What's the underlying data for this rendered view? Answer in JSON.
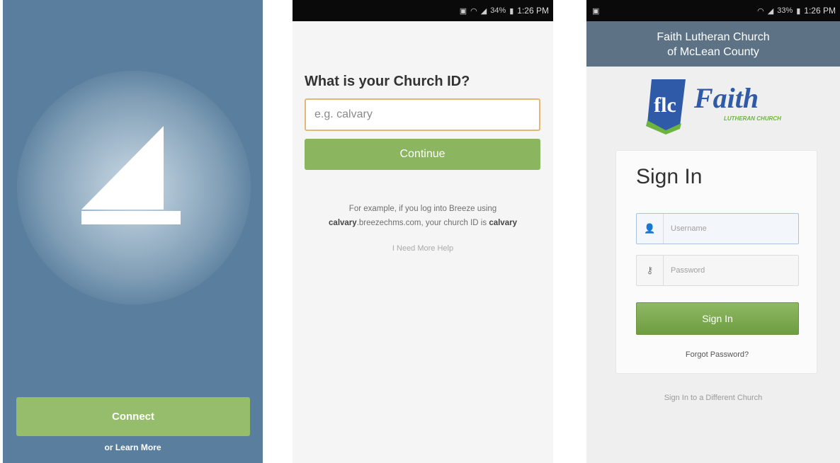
{
  "screen_splash": {
    "connect_label": "Connect",
    "learn_more_label": "or Learn More",
    "background_color": "#5a7f9e",
    "button_color": "#96bd6b"
  },
  "screen_church_id": {
    "status_time": "1:26 PM",
    "status_battery": "34%",
    "question": "What is your Church ID?",
    "input_placeholder": "e.g. calvary",
    "continue_label": "Continue",
    "help_line1": "For example, if you log into Breeze using",
    "help_domain_bold": "calvary",
    "help_domain_rest": ".breezechms.com, your church ID is",
    "help_id_bold": "calvary",
    "more_help_label": "I Need More Help",
    "accent_color": "#8bb55e"
  },
  "screen_signin": {
    "status_time": "1:26 PM",
    "status_battery": "33%",
    "header_line1": "Faith Lutheran Church",
    "header_line2": "of McLean County",
    "logo_mark": "flc",
    "logo_word": "Faith",
    "logo_sub": "LUTHERAN CHURCH",
    "title": "Sign In",
    "username_placeholder": "Username",
    "password_placeholder": "Password",
    "signin_label": "Sign In",
    "forgot_label": "Forgot Password?",
    "different_church_label": "Sign In to a Different Church",
    "header_color": "#5e7285"
  },
  "icons": [
    "wifi-icon",
    "signal-icon",
    "battery-icon",
    "user-icon",
    "key-icon",
    "sailboat-logo-icon"
  ]
}
